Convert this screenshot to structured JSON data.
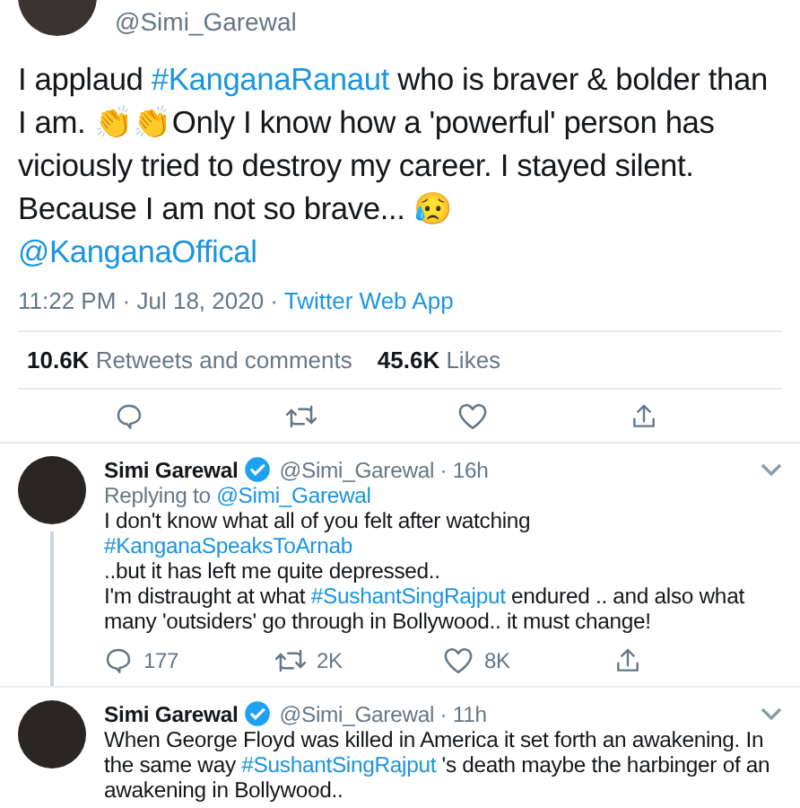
{
  "main_tweet": {
    "handle": "@Simi_Garewal",
    "paragraphs": [
      [
        {
          "kind": "plain",
          "text": "I applaud "
        },
        {
          "kind": "link",
          "text": "#KanganaRanaut"
        },
        {
          "kind": "plain",
          "text": " who is braver & bolder than I am. 👏👏Only I know how a 'powerful' person has viciously tried to destroy my career. I stayed silent. Because I am not so brave... 😥"
        }
      ],
      [
        {
          "kind": "link",
          "text": "@KanganaOffical"
        }
      ]
    ],
    "time": "11:22 PM · Jul 18, 2020 · ",
    "source": "Twitter Web App",
    "stats": [
      {
        "count": "10.6K",
        "label": "Retweets and comments"
      },
      {
        "count": "45.6K",
        "label": "Likes"
      }
    ]
  },
  "replies": [
    {
      "name": "Simi Garewal",
      "handle": "@Simi_Garewal · 16h",
      "replying_to": "Replying to ",
      "replying_handle": "@Simi_Garewal",
      "thread_line": true,
      "paragraphs": [
        [
          {
            "kind": "plain",
            "text": "I don't know what all of you felt after watching "
          },
          {
            "kind": "link",
            "text": "#KanganaSpeaksToArnab"
          }
        ],
        [
          {
            "kind": "plain",
            "text": "..but it has left me quite depressed.."
          }
        ],
        [
          {
            "kind": "plain",
            "text": "I'm distraught at what "
          },
          {
            "kind": "link",
            "text": "#SushantSingRajput"
          },
          {
            "kind": "plain",
            "text": " endured .. and also what many 'outsiders' go through in Bollywood.. it must change!"
          }
        ]
      ],
      "actions": {
        "replies": "177",
        "retweets": "2K",
        "likes": "8K"
      }
    },
    {
      "name": "Simi Garewal",
      "handle": "@Simi_Garewal · 11h",
      "thread_line": false,
      "paragraphs": [
        [
          {
            "kind": "plain",
            "text": "When George Floyd  was killed in America it set forth an awakening. In the same way "
          },
          {
            "kind": "link",
            "text": "#SushantSingRajput"
          },
          {
            "kind": "plain",
            "text": " 's death maybe the harbinger of an awakening in Bollywood.."
          }
        ]
      ]
    }
  ]
}
